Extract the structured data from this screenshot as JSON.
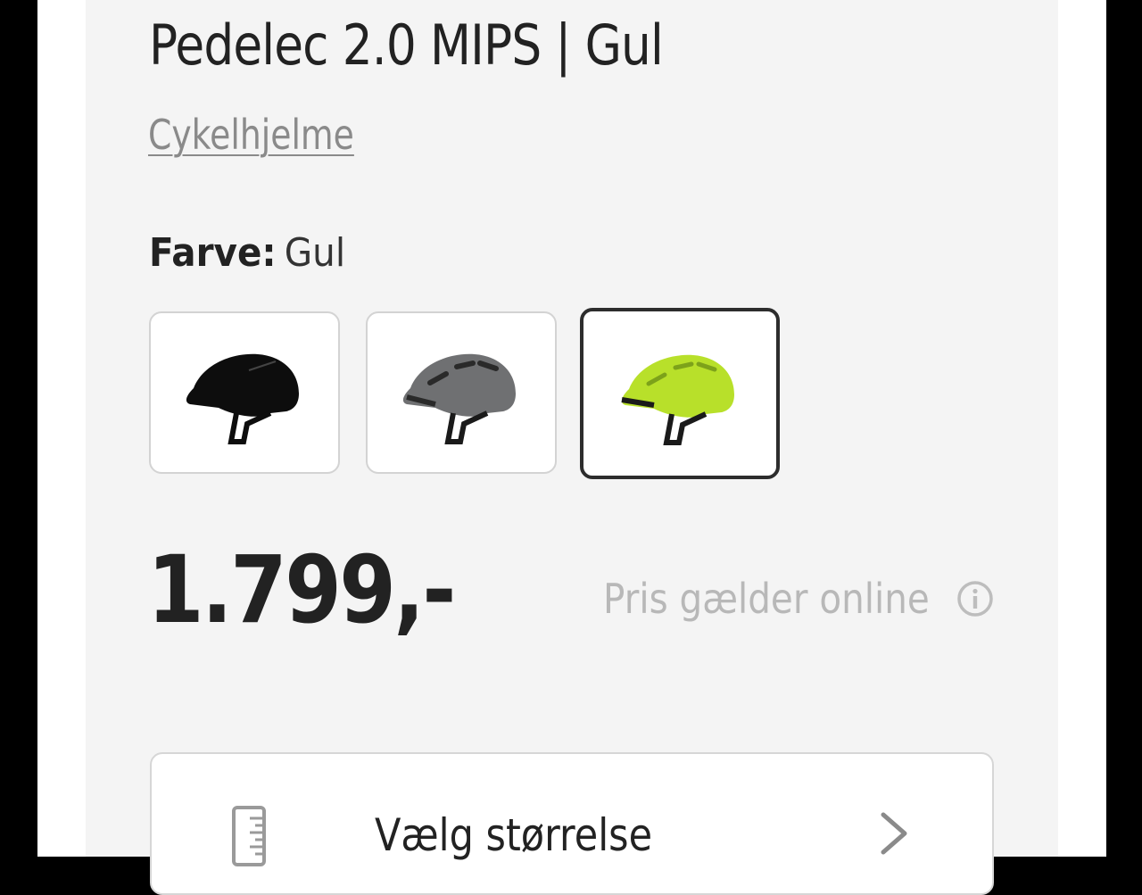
{
  "product": {
    "title": "Pedelec 2.0 MIPS | Gul",
    "category_link": "Cykelhjelme"
  },
  "color_selector": {
    "label": "Farve:",
    "selected_value": "Gul",
    "options": [
      {
        "icon": "helmet-black-icon",
        "color": "#0d0d0d",
        "selected": false
      },
      {
        "icon": "helmet-grey-icon",
        "color": "#6f7072",
        "selected": false
      },
      {
        "icon": "helmet-yellow-icon",
        "color": "#b8e02a",
        "selected": true
      }
    ]
  },
  "pricing": {
    "price": "1.799,-",
    "note": "Pris gælder online",
    "info_icon": "info-icon"
  },
  "size_selector": {
    "label": "Vælg størrelse",
    "icon": "ruler-icon",
    "chevron": "chevron-right-icon"
  },
  "colors": {
    "text": "#222222",
    "muted": "#8a8a8a",
    "panel_bg": "#f4f4f4"
  }
}
